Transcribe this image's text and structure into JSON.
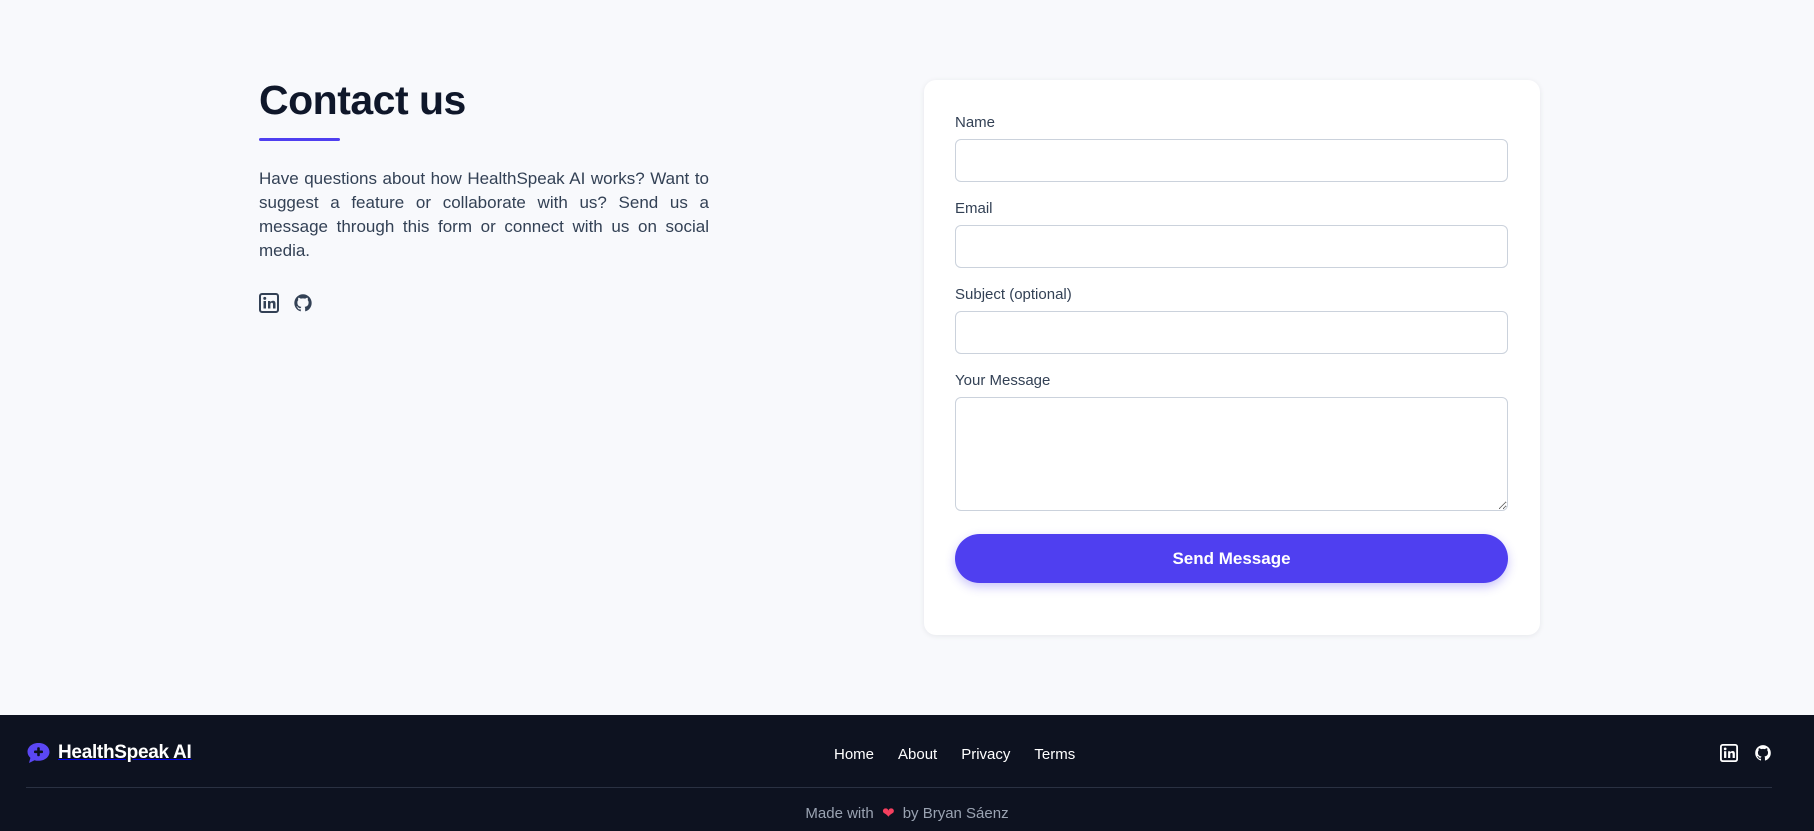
{
  "contact": {
    "title": "Contact us",
    "description": "Have questions about how HealthSpeak AI works? Want to suggest a feature or collaborate with us? Send us a message through this form or connect with us on social media.",
    "social": [
      "linkedin-icon",
      "github-icon"
    ]
  },
  "form": {
    "name_label": "Name",
    "name_value": "",
    "email_label": "Email",
    "email_value": "",
    "subject_label": "Subject (optional)",
    "subject_value": "",
    "message_label": "Your Message",
    "message_value": "",
    "submit_label": "Send Message"
  },
  "footer": {
    "brand_name": "HealthSpeak AI",
    "nav": [
      "Home",
      "About",
      "Privacy",
      "Terms"
    ],
    "credit_prefix": "Made with",
    "credit_suffix": "by Bryan Sáenz"
  },
  "colors": {
    "accent": "#4f3ff0",
    "footer_bg": "#0d1220",
    "heart": "#f43f5e"
  }
}
